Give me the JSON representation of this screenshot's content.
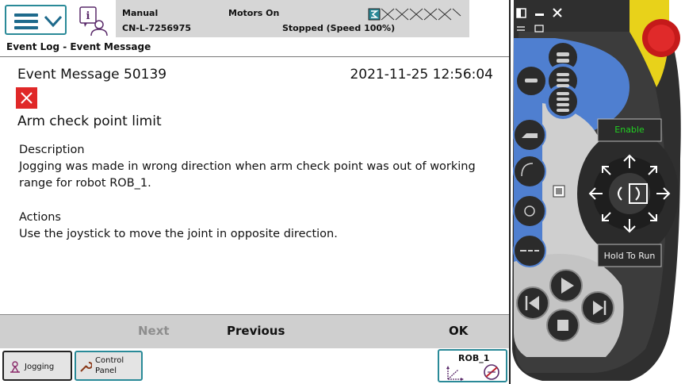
{
  "status": {
    "mode": "Manual",
    "controller": "CN-L-7256975",
    "motors": "Motors On",
    "state": "Stopped (Speed 100%)"
  },
  "breadcrumb": "Event Log - Event Message",
  "event": {
    "title": "Event Message 50139",
    "datetime": "2021-11-25 12:56:04",
    "headline": "Arm check point limit",
    "description_label": "Description",
    "description_text": "Jogging was made in wrong direction when arm check point was out of working range for robot ROB_1.",
    "actions_label": "Actions",
    "actions_text": "Use the joystick to move the joint in opposite direction."
  },
  "buttons": {
    "next": "Next",
    "previous": "Previous",
    "ok": "OK"
  },
  "taskbar": {
    "jogging": "Jogging",
    "control_panel_1": "Control",
    "control_panel_2": "Panel",
    "rob": "ROB_1"
  },
  "flexpendant": {
    "enable": "Enable",
    "hold_to_run": "Hold To Run"
  },
  "colors": {
    "accent": "#2a8a98",
    "error": "#e02828",
    "pendant_blue": "#3f6fc4",
    "pendant_dark": "#2b2b2b",
    "enable_text": "#22d022"
  }
}
